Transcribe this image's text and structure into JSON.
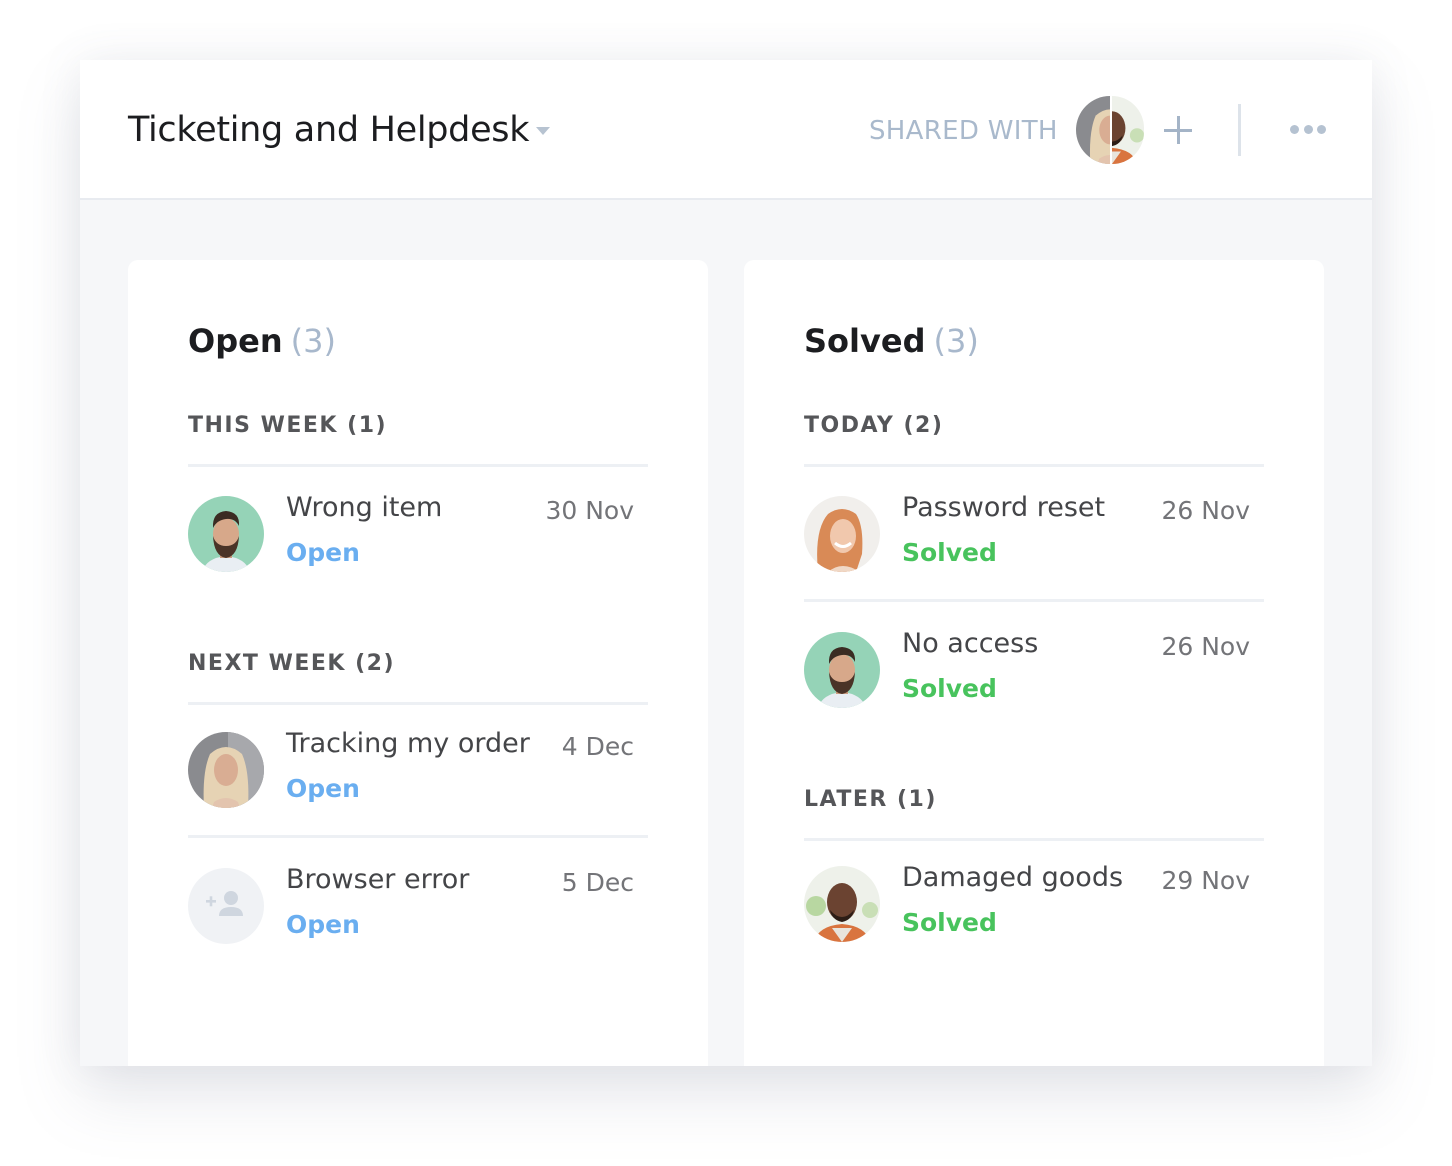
{
  "header": {
    "title": "Ticketing and Helpdesk",
    "shared_with_label": "SHARED WITH",
    "shared_avatars": [
      "blonde-woman-avatar",
      "smiling-man-avatar"
    ],
    "add_share_icon": "plus-icon",
    "more_icon": "more-horizontal-icon"
  },
  "colors": {
    "open_status": "#6aaef0",
    "solved_status": "#48c35d",
    "muted": "#a8b8cc"
  },
  "columns": {
    "open": {
      "title": "Open",
      "count": "(3)",
      "groups": [
        {
          "label": "THIS WEEK (1)",
          "tickets": [
            {
              "title": "Wrong item",
              "status": "Open",
              "date": "30 Nov",
              "avatar": "bearded-man-avatar"
            }
          ]
        },
        {
          "label": "NEXT WEEK (2)",
          "tickets": [
            {
              "title": "Tracking my order",
              "status": "Open",
              "date": "4 Dec",
              "avatar": "blonde-woman-avatar"
            },
            {
              "title": "Browser error",
              "status": "Open",
              "date": "5 Dec",
              "avatar": "add-person-placeholder"
            }
          ]
        }
      ]
    },
    "solved": {
      "title": "Solved",
      "count": "(3)",
      "groups": [
        {
          "label": "TODAY (2)",
          "tickets": [
            {
              "title": "Password reset",
              "status": "Solved",
              "date": "26 Nov",
              "avatar": "redhead-woman-avatar"
            },
            {
              "title": "No access",
              "status": "Solved",
              "date": "26 Nov",
              "avatar": "bearded-man-avatar"
            }
          ]
        },
        {
          "label": "LATER (1)",
          "tickets": [
            {
              "title": "Damaged goods",
              "status": "Solved",
              "date": "29 Nov",
              "avatar": "smiling-man-avatar"
            }
          ]
        }
      ]
    }
  }
}
